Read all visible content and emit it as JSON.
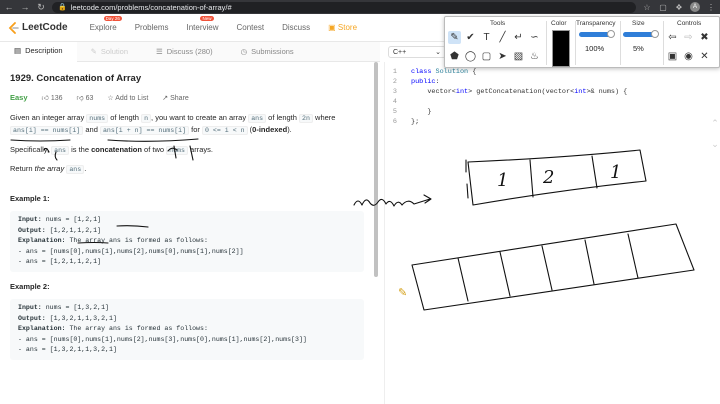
{
  "browser": {
    "url": "leetcode.com/problems/concatenation-of-array/#",
    "avatar": "A"
  },
  "header": {
    "logo": "LeetCode",
    "nav": [
      "Explore",
      "Problems",
      "Interview",
      "Contest",
      "Discuss",
      "Store"
    ],
    "explore_badge": "Day 26",
    "interview_badge": "New"
  },
  "tabs": [
    {
      "label": "Description"
    },
    {
      "label": "Solution"
    },
    {
      "label": "Discuss (280)"
    },
    {
      "label": "Submissions"
    }
  ],
  "problem": {
    "title": "1929. Concatenation of Array",
    "difficulty": "Easy",
    "likes": "136",
    "dislikes": "63",
    "add_to_list": "Add to List",
    "share": "Share",
    "para1_a": "Given an integer array ",
    "para1_b": "nums",
    "para1_c": " of length ",
    "para1_d": "n",
    "para1_e": ", you want to create an array ",
    "para1_f": "ans",
    "para1_g": " of length ",
    "para1_h": "2n",
    "para1_i": " where",
    "para1_j": "ans[i] == nums[i]",
    "para1_k": " and ",
    "para1_l": "ans[i + n] == nums[i]",
    "para1_m": " for ",
    "para1_n": "0 <= i < n",
    "para1_o": " (",
    "para1_p": "0-indexed",
    "para1_q": ").",
    "para2_a": "Specifically, ",
    "para2_b": "ans",
    "para2_c": " is the ",
    "para2_d": "concatenation",
    "para2_e": " of two ",
    "para2_f": "nums",
    "para2_g": " arrays.",
    "para3_a": "Return ",
    "para3_b": "the array",
    "para3_c": "ans",
    "para3_d": ".",
    "ex1_title": "Example 1:",
    "ex1_input_label": "Input:",
    "ex1_input": " nums = [1,2,1]",
    "ex1_output_label": "Output:",
    "ex1_output": " [1,2,1,1,2,1]",
    "ex1_expl_label": "Explanation:",
    "ex1_expl": " The array ans is formed as follows:",
    "ex1_line1": "- ans = [nums[0],nums[1],nums[2],nums[0],nums[1],nums[2]]",
    "ex1_line2": "- ans = [1,2,1,1,2,1]",
    "ex2_title": "Example 2:",
    "ex2_input_label": "Input:",
    "ex2_input": " nums = [1,3,2,1]",
    "ex2_output_label": "Output:",
    "ex2_output": " [1,3,2,1,1,3,2,1]",
    "ex2_expl_label": "Explanation:",
    "ex2_expl": " The array ans is formed as follows:",
    "ex2_line1": "- ans = [nums[0],nums[1],nums[2],nums[3],nums[0],nums[1],nums[2],nums[3]]",
    "ex2_line2": "- ans = [1,3,2,1,1,3,2,1]"
  },
  "editor": {
    "language": "C++",
    "lines": [
      {
        "n": "1",
        "text": "class Solution {"
      },
      {
        "n": "2",
        "text": "public:"
      },
      {
        "n": "3",
        "text": "    vector<int> getConcatenation(vector<int>& nums) {"
      },
      {
        "n": "4",
        "text": ""
      },
      {
        "n": "5",
        "text": "    }"
      },
      {
        "n": "6",
        "text": "};"
      }
    ]
  },
  "annotation_toolbar": {
    "tools_label": "Tools",
    "color_label": "Color",
    "transparency_label": "Transparency",
    "transparency_value": "100%",
    "size_label": "Size",
    "size_value": "5%",
    "controls_label": "Controls",
    "current_color": "#000000"
  },
  "ink_labels": {
    "mapping_word": "nums",
    "top_array_values": [
      "1",
      "2",
      "1"
    ]
  },
  "colors": {
    "easy": "#43a047",
    "store": "#f5a623",
    "slider": "#2f7ed8"
  }
}
